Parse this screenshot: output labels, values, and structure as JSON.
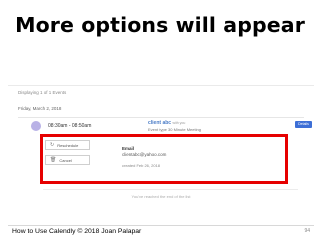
{
  "slide": {
    "title": "More options will appear",
    "footer": "How to Use Calendly © 2018 Joan Palapar",
    "page_number": "94"
  },
  "app": {
    "displaying": "Displaying 1 of 1 Events",
    "date_header": "Friday, March 2, 2018",
    "event": {
      "time_range": "08:30am - 08:50am",
      "invitee_name": "client abc",
      "invitee_suffix": "with you",
      "event_type": "Event type 30 Minute Meeting",
      "details_button": "Details",
      "status_dot_color": "#b9b2e6"
    },
    "options": {
      "reschedule_label": "Reschedule",
      "reschedule_icon": "refresh-icon",
      "cancel_label": "Cancel",
      "cancel_icon": "trash-icon",
      "email_label": "Email",
      "email_value": "clientabc@yahoo.com",
      "created": "created Feb 26, 2018"
    },
    "end_note": "You've reached the end of the list",
    "highlight_color": "#e60000"
  }
}
